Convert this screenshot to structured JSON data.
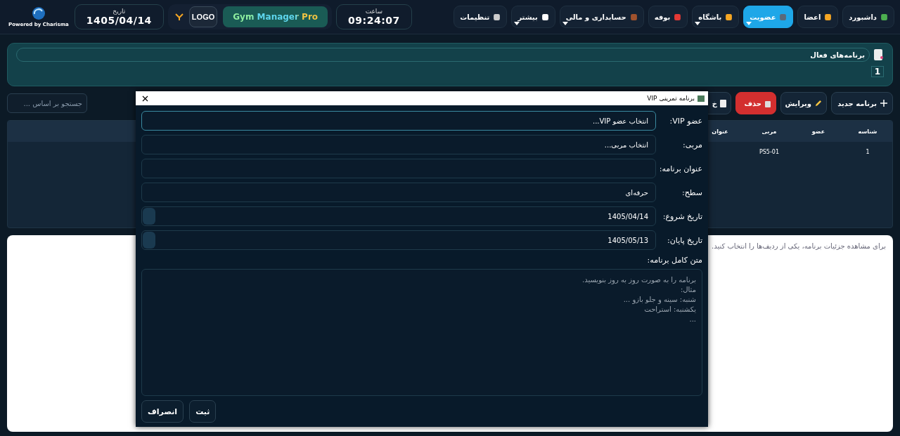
{
  "nav": [
    {
      "label": "داشبورد",
      "selected": false,
      "dropdown": false
    },
    {
      "label": "اعضا",
      "selected": false,
      "dropdown": false
    },
    {
      "label": "عضویت",
      "selected": true,
      "dropdown": true
    },
    {
      "label": "باشگاه",
      "selected": false,
      "dropdown": true
    },
    {
      "label": "بوفه",
      "selected": false,
      "dropdown": false
    },
    {
      "label": "حسابداری و مالی",
      "selected": false,
      "dropdown": true
    },
    {
      "label": "بیشتر",
      "selected": false,
      "dropdown": true
    },
    {
      "label": "تنظیمات",
      "selected": false,
      "dropdown": false
    }
  ],
  "clock": {
    "label": "ساعت",
    "value": "09:24:07"
  },
  "brand": {
    "logo": "LOGO",
    "name": "Gym Manager Pro"
  },
  "date": {
    "label": "تاریخ",
    "value": "1405/04/14"
  },
  "powered_by": "Powered by Charisma",
  "stats": {
    "title": "برنامه‌های فعال",
    "value": "1"
  },
  "toolbar": {
    "buttons": [
      {
        "label": "برنامه جدید",
        "kind": "add"
      },
      {
        "label": "ویرایش",
        "kind": "edit"
      },
      {
        "label": "حذف",
        "kind": "delete"
      },
      {
        "label": "خ",
        "kind": "export"
      }
    ],
    "search": {
      "placeholder": "جستجو بر اساس ..."
    }
  },
  "table": {
    "columns": [
      "شناسه",
      "عضو",
      "مربی",
      "عنوان"
    ],
    "rows": [
      [
        "1",
        "",
        "PS5-01",
        ""
      ]
    ]
  },
  "details": {
    "hint": "برای مشاهده جزئیات برنامه، یکی از ردیف‌ها را انتخاب کنید."
  },
  "dialog": {
    "title": "برنامه تمرینی VIP",
    "fields": [
      {
        "label": "عضو VIP:",
        "value": "انتخاب عضو VIP...",
        "kind": "select"
      },
      {
        "label": "مربی:",
        "value": "انتخاب مربی...",
        "kind": "select"
      },
      {
        "label": "عنوان برنامه:",
        "kind": "text"
      },
      {
        "label": "سطح:",
        "value": "حرفه‌ای",
        "kind": "select"
      },
      {
        "label": "تاریخ شروع:",
        "value": "1405/04/14",
        "kind": "date"
      },
      {
        "label": "تاریخ پایان:",
        "value": "1405/05/13",
        "kind": "date"
      }
    ],
    "text_label": "متن کامل برنامه:",
    "text_placeholder": "برنامه را به صورت روز به روز بنویسید.\nمثال:\nشنبه: سینه و جلو بازو ...\nیکشنبه: استراحت\n...",
    "buttons": [
      "ثبت",
      "انصراف"
    ]
  }
}
